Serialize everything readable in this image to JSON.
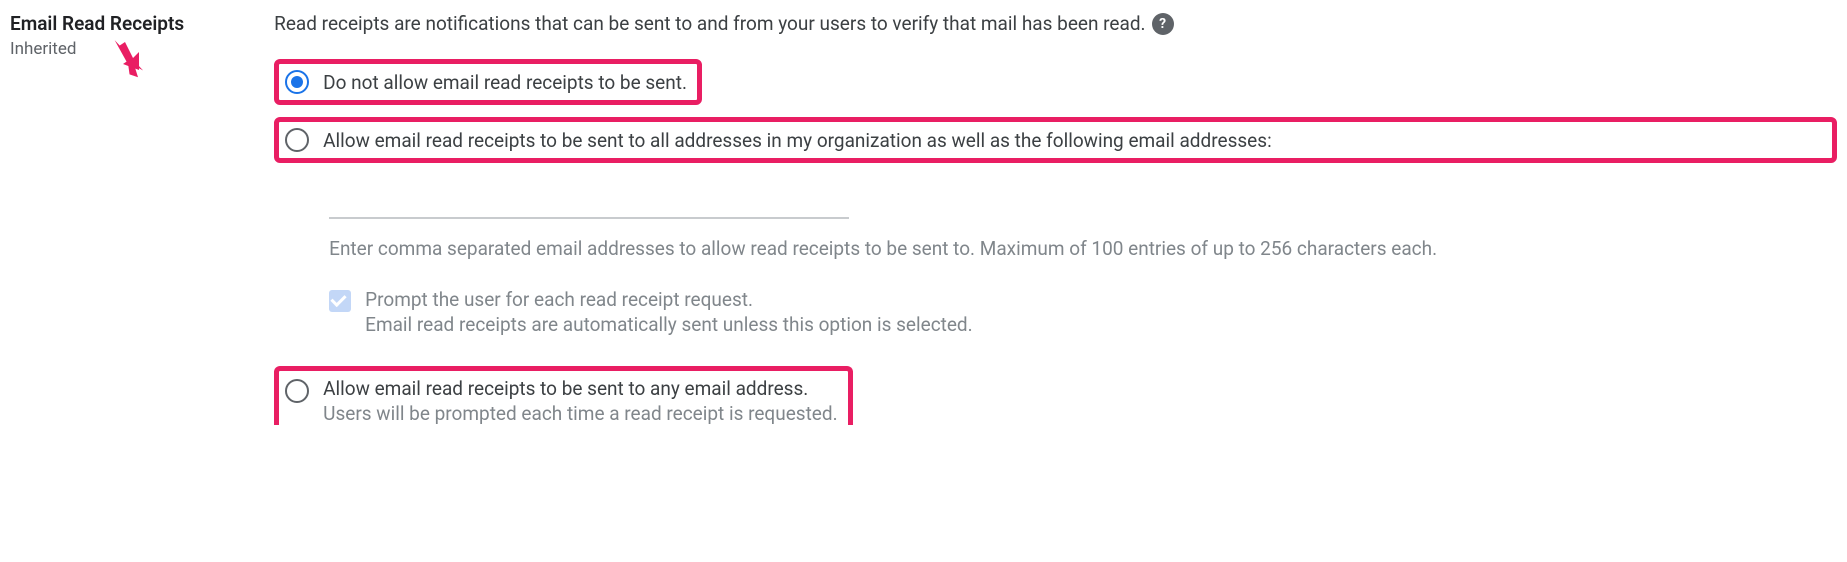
{
  "setting": {
    "title": "Email Read Receipts",
    "sub": "Inherited"
  },
  "description": "Read receipts are notifications that can be sent to and from your users to verify that mail has been read.",
  "options": {
    "opt1": "Do not allow email read receipts to be sent.",
    "opt2": "Allow email read receipts to be sent to all addresses in my organization as well as the following email addresses:",
    "opt3": {
      "label": "Allow email read receipts to be sent to any email address.",
      "sub": "Users will be prompted each time a read receipt is requested."
    }
  },
  "indented": {
    "hint": "Enter comma separated email addresses to allow read receipts to be sent to. Maximum of 100 entries of up to 256 characters each.",
    "checkbox_label": "Prompt the user for each read receipt request.",
    "checkbox_sub": "Email read receipts are automatically sent unless this option is selected."
  },
  "glyph": {
    "help": "?"
  }
}
